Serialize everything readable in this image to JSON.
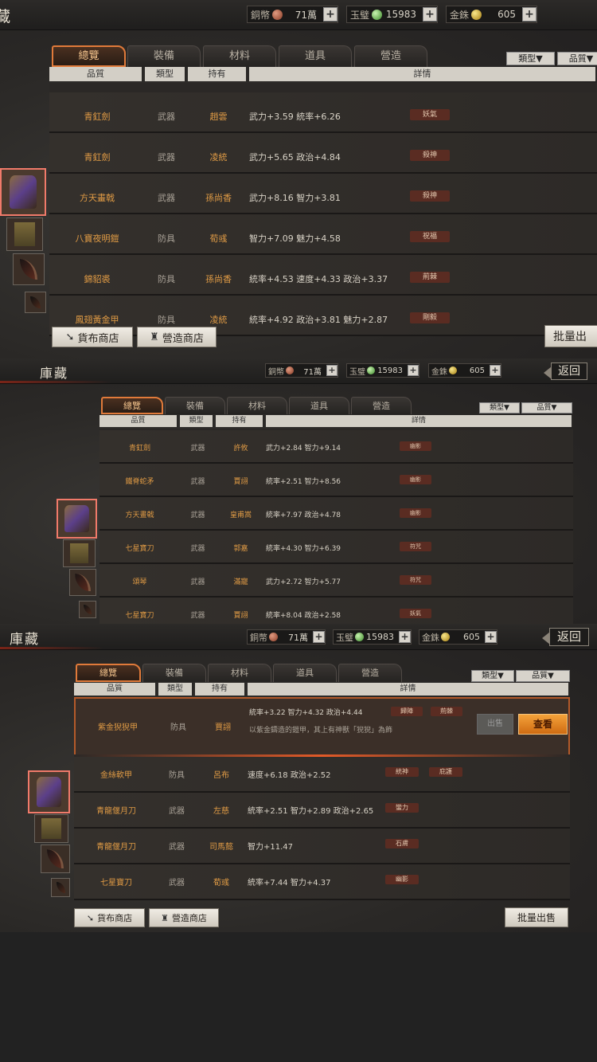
{
  "title": "庫藏",
  "title_partial": "藏",
  "back_label": "返回",
  "resources": {
    "copper_label": "銅幣",
    "copper_value": "71萬",
    "jade_label": "玉璧",
    "jade_value": "15983",
    "gold_label": "金銖",
    "gold_value": "605",
    "plus": "+"
  },
  "tabs": [
    "總覽",
    "裝備",
    "材料",
    "道具",
    "營造"
  ],
  "filters": [
    "類型▼",
    "品質▼"
  ],
  "columns": [
    "品質",
    "類型",
    "持有",
    "詳情"
  ],
  "shops": {
    "coin": "貨布商店",
    "build": "營造商店"
  },
  "bulk_sell": "批量出售",
  "bulk_sell_partial": "批量出",
  "panel1_rows": [
    {
      "name": "青釭劍",
      "type": "武器",
      "owner": "趙雲",
      "detail": "武力+3.59 統率+6.26",
      "tags": [
        "妖氣"
      ]
    },
    {
      "name": "青釭劍",
      "type": "武器",
      "owner": "凌統",
      "detail": "武力+5.65 政治+4.84",
      "tags": [
        "殺神"
      ]
    },
    {
      "name": "方天畫戟",
      "type": "武器",
      "owner": "孫尚香",
      "detail": "武力+8.16 智力+3.81",
      "tags": [
        "殺神"
      ]
    },
    {
      "name": "八寶夜明鎧",
      "type": "防具",
      "owner": "荀彧",
      "detail": "智力+7.09 魅力+4.58",
      "tags": [
        "祝福"
      ]
    },
    {
      "name": "錦貂裘",
      "type": "防具",
      "owner": "孫尚香",
      "detail": "統率+4.53 速度+4.33 政治+3.37",
      "tags": [
        "荊棘"
      ]
    },
    {
      "name": "鳳翅黃金甲",
      "type": "防具",
      "owner": "凌統",
      "detail": "統率+4.92 政治+3.81 魅力+2.87",
      "tags": [
        "剛毅"
      ]
    }
  ],
  "panel2_rows": [
    {
      "name": "青釭劍",
      "type": "武器",
      "owner": "許攸",
      "detail": "武力+2.84 智力+9.14",
      "tags": [
        "幽影"
      ]
    },
    {
      "name": "鐵脊蛇矛",
      "type": "武器",
      "owner": "賈詡",
      "detail": "統率+2.51 智力+8.56",
      "tags": [
        "幽影"
      ]
    },
    {
      "name": "方天畫戟",
      "type": "武器",
      "owner": "皇甫嵩",
      "detail": "統率+7.97 政治+4.78",
      "tags": [
        "幽影"
      ]
    },
    {
      "name": "七星寶刀",
      "type": "武器",
      "owner": "郭嘉",
      "detail": "統率+4.30 智力+6.39",
      "tags": [
        "符咒"
      ]
    },
    {
      "name": "頌琴",
      "type": "武器",
      "owner": "滿寵",
      "detail": "武力+2.72 智力+5.77",
      "tags": [
        "符咒"
      ]
    },
    {
      "name": "七星寶刀",
      "type": "武器",
      "owner": "賈詡",
      "detail": "統率+8.04 政治+2.58",
      "tags": [
        "妖氣"
      ]
    }
  ],
  "panel3_expanded": {
    "name": "紫金猊猊甲",
    "type": "防具",
    "owner": "賈詡",
    "detail": "統率+3.22 智力+4.32 政治+4.44",
    "tags": [
      "歸陣",
      "荊棘"
    ],
    "desc": "以紫金鑄造的鎧甲，其上有神獸「猊猊」為飾",
    "btn_disabled": "出售",
    "btn_view": "查看"
  },
  "panel3_rows": [
    {
      "name": "金絲軟甲",
      "type": "防具",
      "owner": "呂布",
      "detail": "速度+6.18 政治+2.52",
      "tags": [
        "統神",
        "庇護"
      ]
    },
    {
      "name": "青龍偃月刀",
      "type": "武器",
      "owner": "左慈",
      "detail": "統率+2.51 智力+2.89 政治+2.65",
      "tags": [
        "蠻力"
      ]
    },
    {
      "name": "青龍偃月刀",
      "type": "武器",
      "owner": "司馬懿",
      "detail": "智力+11.47",
      "tags": [
        "石膚"
      ]
    },
    {
      "name": "七星寶刀",
      "type": "武器",
      "owner": "荀彧",
      "detail": "統率+7.44 智力+4.37",
      "tags": [
        "幽影"
      ]
    }
  ],
  "colors": {
    "accent": "#e07a3a",
    "name_text": "#e09b45",
    "tag_bg": "#5a2c22"
  }
}
